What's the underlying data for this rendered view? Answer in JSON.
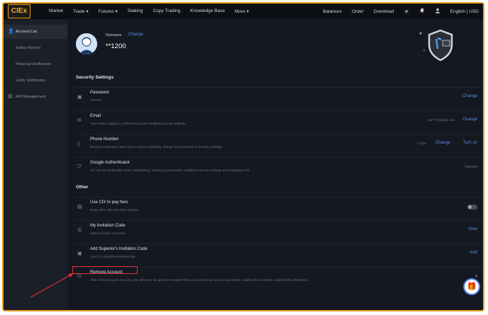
{
  "logo": {
    "text": "CIEx"
  },
  "nav": {
    "items": [
      "Market",
      "Trade ▾",
      "Futures ▾",
      "Staking",
      "Copy Trading",
      "Knowledge Base",
      "More ▾"
    ],
    "right": [
      "Balances",
      "Order",
      "Download"
    ],
    "language": "English | USD"
  },
  "sidebar": {
    "items": [
      {
        "label": "Account List",
        "active": true
      },
      {
        "label": "Safety Record",
        "active": false
      },
      {
        "label": "Personal Verification",
        "active": false
      },
      {
        "label": "Entity Verification",
        "active": false
      },
      {
        "label": "API Management",
        "active": false
      }
    ]
  },
  "profile": {
    "nickname_label": "Nickname",
    "change_label": "Change",
    "user_id": "**1200"
  },
  "security": {
    "title": "Security Settings",
    "rows": [
      {
        "title": "Password",
        "desc": "••••••••••",
        "action": "Change"
      },
      {
        "title": "Email",
        "desc": "Used when logging in, withdrawing and modifying security settings",
        "extra": "eaz***@gmail.com",
        "action": "Change"
      },
      {
        "title": "Phone Number",
        "desc": "Receive verification SMS that is used to withdraw, change the password or security settings",
        "extra": "**1200",
        "mid": "Change",
        "action": "Turn on"
      },
      {
        "title": "Google Authenticator",
        "desc": "API Secure verification when withdrawing, retrieving passwords, modifying security settings and managing API",
        "status": "Opened"
      }
    ]
  },
  "other": {
    "title": "Other",
    "rows": [
      {
        "title": "Use CIX to pay fees",
        "desc": "Enjoy 35% discount when trading",
        "toggle": "off"
      },
      {
        "title": "My Invitation Code",
        "desc": "Used to invite new users",
        "action": "View"
      },
      {
        "title": "Add Superior's Invitation Code",
        "desc": "Used for Invitation Relationship",
        "action": "Add"
      },
      {
        "title": "Remove Account",
        "desc": "After removing your account, you will never be able to re-register this account and its sub-account email, mobile phone number, and identity information.",
        "action": "›"
      }
    ]
  },
  "colors": {
    "accent": "#5a8ee6",
    "highlight": "#e03030",
    "frame": "#f0a020"
  }
}
